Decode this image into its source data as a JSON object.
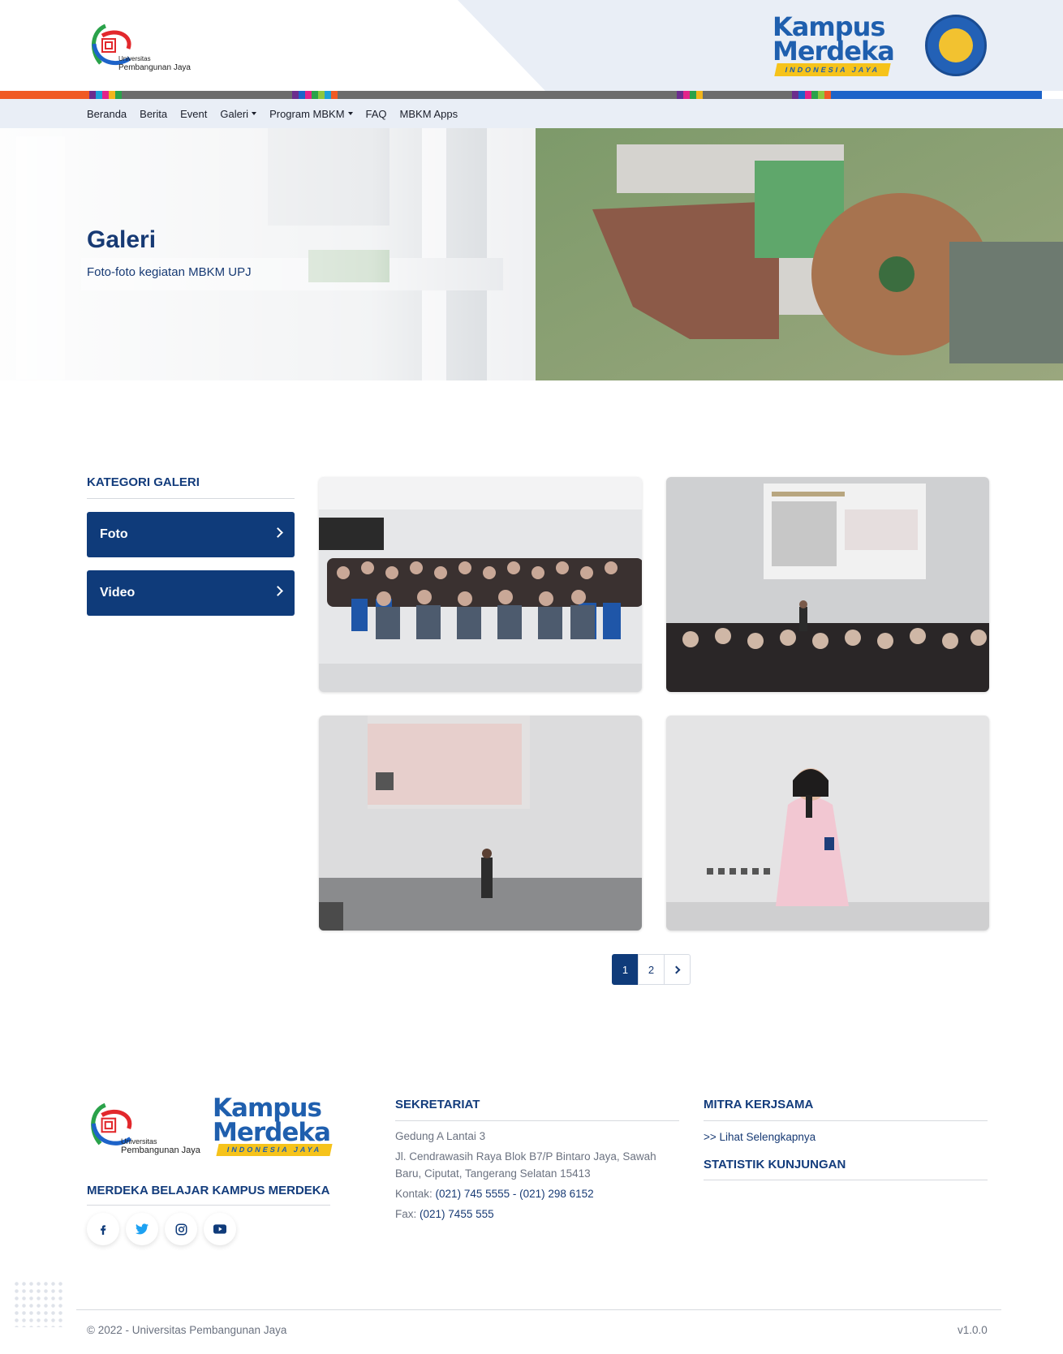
{
  "header": {
    "upj_logo_line1": "Universitas",
    "upj_logo_line2": "Pembangunan Jaya",
    "km_logo_line1": "Kampus",
    "km_logo_line2": "Merdeka",
    "km_logo_tagline": "INDONESIA JAYA"
  },
  "nav": {
    "items": [
      {
        "label": "Beranda",
        "dropdown": false
      },
      {
        "label": "Berita",
        "dropdown": false
      },
      {
        "label": "Event",
        "dropdown": false
      },
      {
        "label": "Galeri",
        "dropdown": true
      },
      {
        "label": "Program MBKM",
        "dropdown": true
      },
      {
        "label": "FAQ",
        "dropdown": false
      },
      {
        "label": "MBKM Apps",
        "dropdown": false
      }
    ]
  },
  "hero": {
    "title": "Galeri",
    "subtitle": "Foto-foto kegiatan MBKM UPJ"
  },
  "sidebar": {
    "title": "KATEGORI GALERI",
    "categories": [
      {
        "label": "Foto"
      },
      {
        "label": "Video"
      }
    ]
  },
  "gallery": {
    "photos": [
      {
        "subject": "audience-seated"
      },
      {
        "subject": "presentation-slide"
      },
      {
        "subject": "speaker-stage"
      },
      {
        "subject": "speaker-microphone"
      }
    ]
  },
  "pagination": {
    "pages": [
      "1",
      "2"
    ],
    "current": "1"
  },
  "footer": {
    "upj_logo_line1": "Universitas",
    "upj_logo_line2": "Pembangunan Jaya",
    "km_logo_line1": "Kampus",
    "km_logo_line2": "Merdeka",
    "km_logo_tagline": "INDONESIA JAYA",
    "brand_heading": "MERDEKA BELAJAR KAMPUS MERDEKA",
    "social_icons": [
      "facebook-icon",
      "twitter-icon",
      "instagram-icon",
      "youtube-icon"
    ],
    "sekretariat": {
      "heading": "SEKRETARIAT",
      "line1": "Gedung A Lantai 3",
      "address": "Jl. Cendrawasih Raya Blok B7/P Bintaro Jaya, Sawah Baru, Ciputat, Tangerang Selatan 15413",
      "kontak_label": "Kontak:",
      "kontak_value": "(021) 745 5555 - (021) 298 6152",
      "fax_label": "Fax:",
      "fax_value": "(021) 7455 555"
    },
    "mitra": {
      "heading": "MITRA KERJSAMA",
      "link": ">> Lihat Selengkapnya"
    },
    "statistik_heading": "STATISTIK KUNJUNGAN",
    "copyright": "© 2022 - Universitas Pembangunan Jaya",
    "version": "v1.0.0"
  },
  "colors": {
    "primary": "#0f3b7a",
    "heading": "#133c7c",
    "nav_bg": "#e9eef6",
    "accent_orange": "#f05a24",
    "accent_blue": "#1d63c9"
  }
}
